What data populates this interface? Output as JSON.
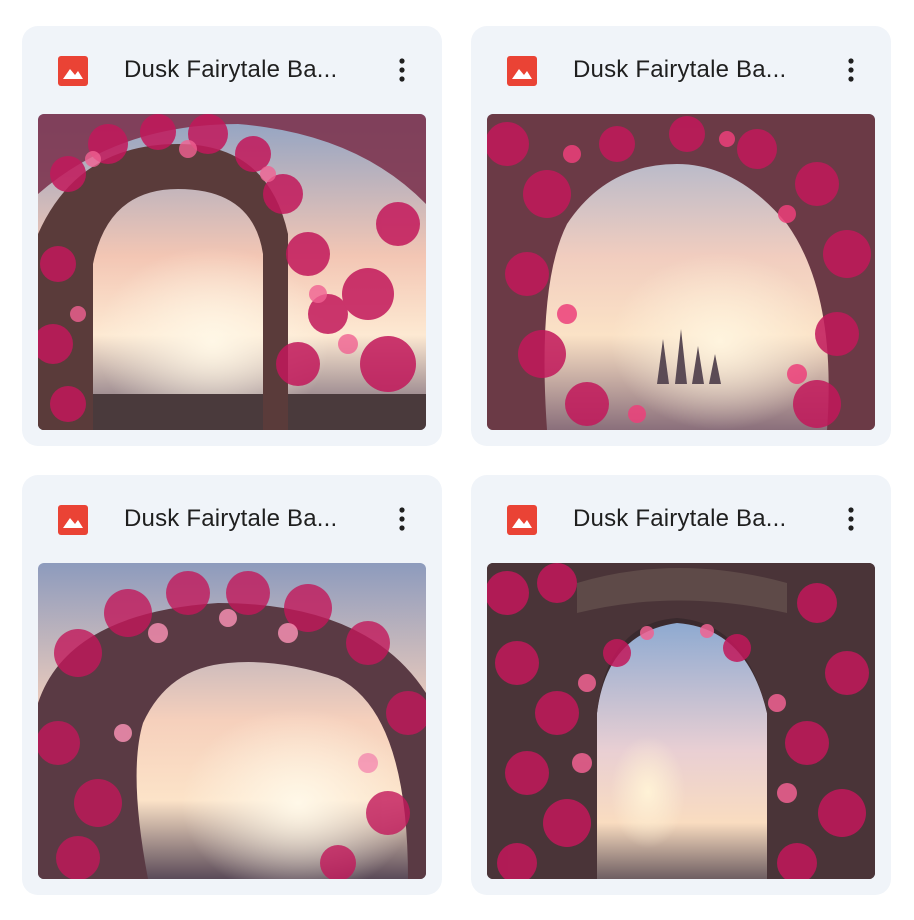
{
  "files": [
    {
      "title": "Dusk Fairytale Ba...",
      "file_type_icon": "image-file-icon",
      "menu_icon": "more-vert-icon",
      "thumbnail": "pink flower archway framing a sunset sky"
    },
    {
      "title": "Dusk Fairytale Ba...",
      "file_type_icon": "image-file-icon",
      "menu_icon": "more-vert-icon",
      "thumbnail": "round flower arch with a sunset and distant castle spires"
    },
    {
      "title": "Dusk Fairytale Ba...",
      "file_type_icon": "image-file-icon",
      "menu_icon": "more-vert-icon",
      "thumbnail": "blossoming tree arch with glowing sunset horizon"
    },
    {
      "title": "Dusk Fairytale Ba...",
      "file_type_icon": "image-file-icon",
      "menu_icon": "more-vert-icon",
      "thumbnail": "ornate stone arch covered in pink roses opening to sky"
    }
  ],
  "colors": {
    "card_background": "#f0f4f9",
    "image_icon_red": "#ea4335",
    "title_text": "#1f1f1f",
    "flower_pink": "#c2185b"
  }
}
